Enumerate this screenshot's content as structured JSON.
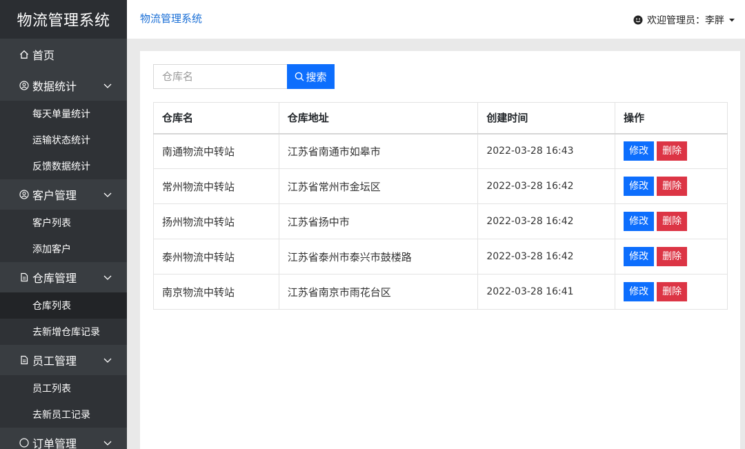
{
  "sidebar": {
    "brand": "物流管理系统",
    "home": "首页",
    "groups": [
      {
        "label": "数据统计",
        "items": [
          "每天单量统计",
          "运输状态统计",
          "反馈数据统计"
        ]
      },
      {
        "label": "客户管理",
        "items": [
          "客户列表",
          "添加客户"
        ]
      },
      {
        "label": "仓库管理",
        "items": [
          "仓库列表",
          "去新增仓库记录"
        ]
      },
      {
        "label": "员工管理",
        "items": [
          "员工列表",
          "去新员工记录"
        ]
      },
      {
        "label": "订单管理",
        "items": []
      }
    ],
    "active_item": "仓库列表"
  },
  "header": {
    "title": "物流管理系统",
    "user_greeting": "欢迎管理员：李胖"
  },
  "search": {
    "placeholder": "仓库名",
    "button_label": "搜索"
  },
  "table": {
    "headers": [
      "仓库名",
      "仓库地址",
      "创建时间",
      "操作"
    ],
    "rows": [
      {
        "name": "南通物流中转站",
        "address": "江苏省南通市如皋市",
        "created": "2022-03-28 16:43"
      },
      {
        "name": "常州物流中转站",
        "address": "江苏省常州市金坛区",
        "created": "2022-03-28 16:42"
      },
      {
        "name": "扬州物流中转站",
        "address": "江苏省扬中市",
        "created": "2022-03-28 16:42"
      },
      {
        "name": "泰州物流中转站",
        "address": "江苏省泰州市泰兴市鼓楼路",
        "created": "2022-03-28 16:42"
      },
      {
        "name": "南京物流中转站",
        "address": "江苏省南京市雨花台区",
        "created": "2022-03-28 16:41"
      }
    ],
    "edit_label": "修改",
    "delete_label": "删除"
  },
  "colors": {
    "sidebar_bg": "#393d41",
    "primary": "#0d6efd",
    "danger": "#dc3545",
    "header_title": "#1a6fd6"
  },
  "icons": {
    "home": "home-icon",
    "stats": "stats-icon",
    "customer": "user-icon",
    "warehouse": "document-icon",
    "staff": "document-icon",
    "chevron": "chevron-down-icon",
    "user_avatar": "smiley-icon",
    "search": "search-icon"
  }
}
